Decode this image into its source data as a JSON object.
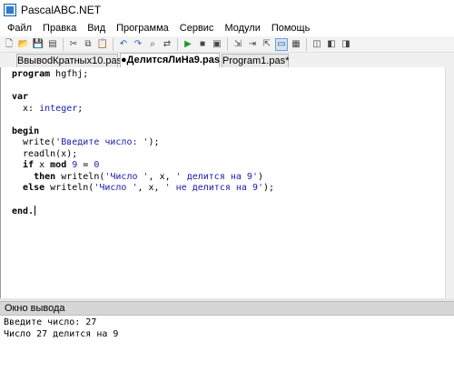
{
  "window": {
    "title": "PascalABC.NET"
  },
  "menu": [
    "Файл",
    "Правка",
    "Вид",
    "Программа",
    "Сервис",
    "Модули",
    "Помощь"
  ],
  "toolbar": {
    "buttons": [
      {
        "name": "new-file-icon",
        "glyph": "🗋"
      },
      {
        "name": "open-file-icon",
        "glyph": "📂"
      },
      {
        "name": "save-icon",
        "glyph": "💾"
      },
      {
        "name": "save-all-icon",
        "glyph": "▤"
      },
      {
        "name": "cut-icon",
        "glyph": "✂"
      },
      {
        "name": "copy-icon",
        "glyph": "⧉"
      },
      {
        "name": "paste-icon",
        "glyph": "📋"
      },
      {
        "name": "undo-icon",
        "glyph": "↶"
      },
      {
        "name": "redo-icon",
        "glyph": "↷"
      },
      {
        "name": "find-icon",
        "glyph": "⌕"
      },
      {
        "name": "replace-icon",
        "glyph": "⇄"
      },
      {
        "name": "run-icon",
        "glyph": "▶"
      },
      {
        "name": "stop-icon",
        "glyph": "■"
      },
      {
        "name": "debug-icon",
        "glyph": "▣"
      },
      {
        "name": "step-into-icon",
        "glyph": "⇲"
      },
      {
        "name": "step-over-icon",
        "glyph": "⇥"
      },
      {
        "name": "step-out-icon",
        "glyph": "⇱"
      },
      {
        "name": "output-window-icon",
        "glyph": "▭"
      },
      {
        "name": "form-designer-icon",
        "glyph": "▦"
      },
      {
        "name": "window-layout-1-icon",
        "glyph": "◫"
      },
      {
        "name": "window-layout-2-icon",
        "glyph": "◧"
      },
      {
        "name": "window-layout-3-icon",
        "glyph": "◨"
      }
    ]
  },
  "tabs": [
    {
      "label": "ВвывodКратных10.pas*",
      "active": false
    },
    {
      "label": "●ДелитсяЛиНа9.pas",
      "active": true
    },
    {
      "label": "Program1.pas*",
      "active": false
    }
  ],
  "editor": {
    "lines": [
      "program hgfhj;",
      "",
      "var",
      "  x: integer;",
      "",
      "begin",
      "  write('Введите число: ');",
      "  readln(x);",
      "  if x mod 9 = 0",
      "    then writeln('Число ', x, ' делится на 9')",
      "  else writeln('Число ', x, ' не делится на 9');",
      "",
      "end."
    ]
  },
  "output": {
    "header": "Окно вывода",
    "lines": [
      "Введите число: 27",
      "Число 27 делится на 9"
    ]
  },
  "colors": {
    "string": "#1a1ab0",
    "number": "#1a1ab0",
    "keyword": "#000000",
    "run_green": "#1a9a2a"
  }
}
